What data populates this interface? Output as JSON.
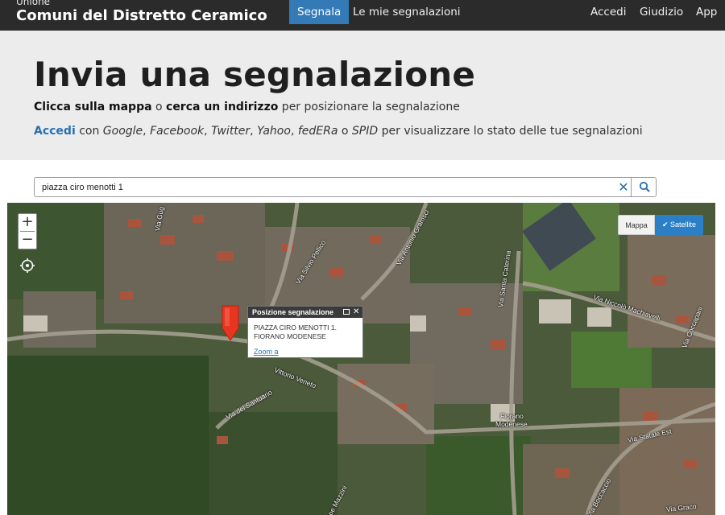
{
  "navbar": {
    "brand_small": "Unione",
    "brand_big": "Comuni del Distretto Ceramico",
    "items": [
      {
        "label": "Segnala"
      },
      {
        "label": "Le mie segnalazioni"
      },
      {
        "label": "Accedi"
      },
      {
        "label": "Giudizio"
      },
      {
        "label": "App"
      }
    ]
  },
  "hero": {
    "title": "Invia una segnalazione",
    "line1": {
      "part1": "Clicca sulla mappa",
      "part2": " o ",
      "part3": "cerca un indirizzo",
      "part4": " per posizionare la segnalazione"
    },
    "line2": {
      "link": "Accedi",
      "t1": " con ",
      "google": "Google",
      "c1": ", ",
      "facebook": "Facebook",
      "c2": ", ",
      "twitter": "Twitter",
      "c3": ", ",
      "yahoo": "Yahoo",
      "c4": ", ",
      "federa": "fedERa",
      "t2": " o ",
      "spid": "SPID",
      "t3": " per visualizzare lo stato delle tue segnalazioni"
    }
  },
  "search": {
    "value": "piazza ciro menotti 1",
    "clear_icon": "close-icon",
    "button_icon": "search-icon"
  },
  "map": {
    "zoom_in": "+",
    "zoom_out": "−",
    "layers": {
      "map": "Mappa",
      "satellite": "Satellite",
      "active": "satellite"
    },
    "popup": {
      "title": "Posizione segnalazione",
      "line1": "PIAZZA CIRO MENOTTI 1.",
      "line2": "FIORANO MODENESE",
      "link": "Zoom a"
    },
    "labels": [
      {
        "text": "Via Gug"
      },
      {
        "text": "Via Silvio Pellico"
      },
      {
        "text": "Via Antonio Gramsci"
      },
      {
        "text": "Via Santa Caterina"
      },
      {
        "text": "Via Niccolò Machiavelli"
      },
      {
        "text": "Via Coccapani"
      },
      {
        "text": "Vittorio Veneto"
      },
      {
        "text": "Via del Santuario"
      },
      {
        "text": "Fiorano"
      },
      {
        "text": "Modenese"
      },
      {
        "text": "Via Statale Est"
      },
      {
        "text": "Via Graco"
      },
      {
        "text": "Via Boccaccio"
      },
      {
        "text": "ppe Mazzini"
      }
    ],
    "colors": {
      "accent": "#337ab7",
      "marker": "#e8351f"
    }
  }
}
